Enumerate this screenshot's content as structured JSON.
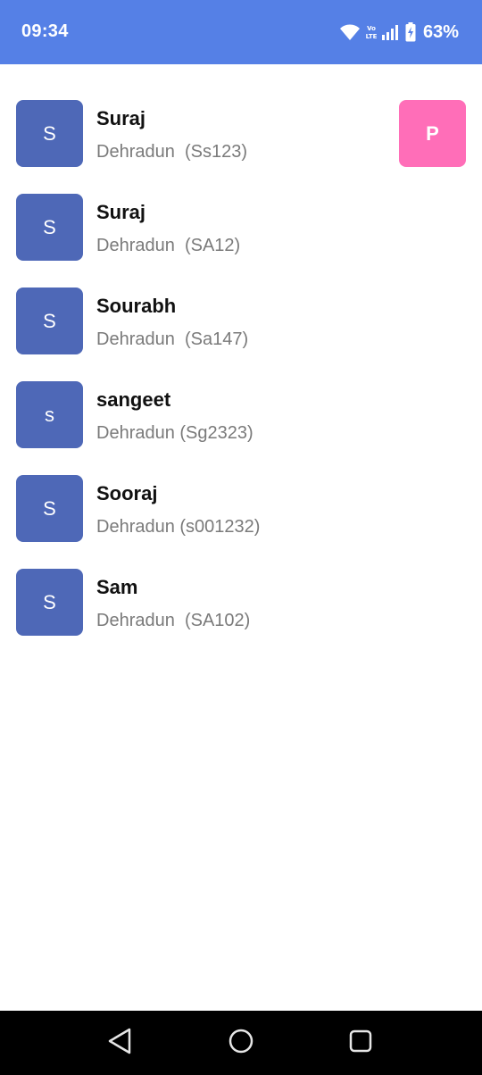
{
  "status_bar": {
    "time": "09:34",
    "battery": "63%",
    "icons": [
      "wifi-icon",
      "volte-icon",
      "signal-icon",
      "battery-icon"
    ]
  },
  "contacts": [
    {
      "initial": "S",
      "name": "Suraj",
      "subtitle": "Dehradun  (Ss123)"
    },
    {
      "initial": "S",
      "name": "Suraj",
      "subtitle": "Dehradun  (SA12)"
    },
    {
      "initial": "S",
      "name": "Sourabh",
      "subtitle": "Dehradun  (Sa147)"
    },
    {
      "initial": "s",
      "name": "sangeet",
      "subtitle": "Dehradun (Sg2323)"
    },
    {
      "initial": "S",
      "name": "Sooraj",
      "subtitle": "Dehradun (s001232)"
    },
    {
      "initial": "S",
      "name": "Sam",
      "subtitle": "Dehradun  (SA102)"
    }
  ],
  "badge": {
    "label": "P"
  },
  "nav_bar": {
    "icons": [
      "back-icon",
      "home-icon",
      "recents-icon"
    ]
  },
  "colors": {
    "status_bar": "#5580e6",
    "avatar": "#4e68b7",
    "badge": "#ff6eb8",
    "nav_bar": "#000000"
  }
}
